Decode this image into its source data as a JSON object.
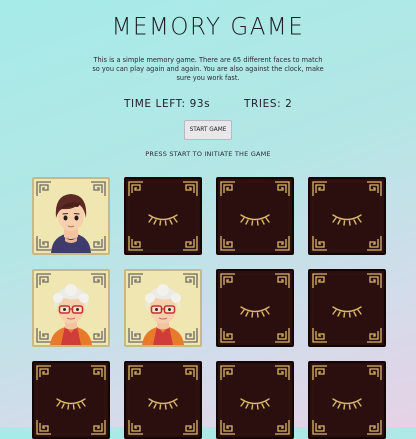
{
  "title": "MEMORY GAME",
  "description": "This is a simple memory game. There are 65 different faces to match so you can play again and again. You are also against the clock, make sure you work fast.",
  "stats": {
    "time_left": "TIME LEFT: 93s",
    "tries": "TRIES: 2"
  },
  "start_button": "START GAME",
  "hint": "PRESS START TO INITIATE THE GAME",
  "colors": {
    "card_back": "#2a0f0e",
    "card_face": "#f0e6b2",
    "ornament_gold": "#d9b869"
  },
  "cards": [
    {
      "state": "face",
      "face": "brown-haired-person"
    },
    {
      "state": "back",
      "face": "closed-eye"
    },
    {
      "state": "back",
      "face": "closed-eye"
    },
    {
      "state": "back",
      "face": "closed-eye"
    },
    {
      "state": "face",
      "face": "white-haired-person-glasses"
    },
    {
      "state": "face",
      "face": "white-haired-person-glasses"
    },
    {
      "state": "back",
      "face": "closed-eye"
    },
    {
      "state": "back",
      "face": "closed-eye"
    },
    {
      "state": "back",
      "face": "closed-eye"
    },
    {
      "state": "back",
      "face": "closed-eye"
    },
    {
      "state": "back",
      "face": "closed-eye"
    },
    {
      "state": "back",
      "face": "closed-eye"
    }
  ]
}
